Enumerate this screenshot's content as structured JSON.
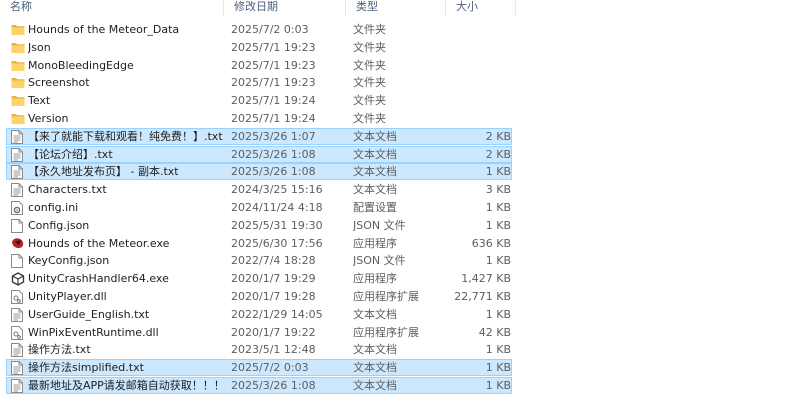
{
  "header": {
    "name": "名称",
    "date": "修改日期",
    "type": "类型",
    "size": "大小"
  },
  "files": [
    {
      "name": "Hounds of the Meteor_Data",
      "date": "2025/7/2 0:03",
      "type": "文件夹",
      "size": "",
      "icon": "folder-icon",
      "selected": false
    },
    {
      "name": "Json",
      "date": "2025/7/1 19:23",
      "type": "文件夹",
      "size": "",
      "icon": "folder-icon",
      "selected": false
    },
    {
      "name": "MonoBleedingEdge",
      "date": "2025/7/1 19:23",
      "type": "文件夹",
      "size": "",
      "icon": "folder-icon",
      "selected": false
    },
    {
      "name": "Screenshot",
      "date": "2025/7/1 19:23",
      "type": "文件夹",
      "size": "",
      "icon": "folder-icon",
      "selected": false
    },
    {
      "name": "Text",
      "date": "2025/7/1 19:24",
      "type": "文件夹",
      "size": "",
      "icon": "folder-icon",
      "selected": false
    },
    {
      "name": "Version",
      "date": "2025/7/1 19:24",
      "type": "文件夹",
      "size": "",
      "icon": "folder-icon",
      "selected": false
    },
    {
      "name": "【来了就能下载和观看！纯免费！】.txt",
      "date": "2025/3/26 1:07",
      "type": "文本文档",
      "size": "2 KB",
      "icon": "text-file-icon",
      "selected": true
    },
    {
      "name": "【论坛介绍】.txt",
      "date": "2025/3/26 1:08",
      "type": "文本文档",
      "size": "2 KB",
      "icon": "text-file-icon",
      "selected": true
    },
    {
      "name": "【永久地址发布页】 - 副本.txt",
      "date": "2025/3/26 1:08",
      "type": "文本文档",
      "size": "1 KB",
      "icon": "text-file-icon",
      "selected": true
    },
    {
      "name": "Characters.txt",
      "date": "2024/3/25 15:16",
      "type": "文本文档",
      "size": "3 KB",
      "icon": "text-file-icon",
      "selected": false
    },
    {
      "name": "config.ini",
      "date": "2024/11/24 4:18",
      "type": "配置设置",
      "size": "1 KB",
      "icon": "config-file-icon",
      "selected": false
    },
    {
      "name": "Config.json",
      "date": "2025/5/31 19:30",
      "type": "JSON 文件",
      "size": "1 KB",
      "icon": "blank-file-icon",
      "selected": false
    },
    {
      "name": "Hounds of the Meteor.exe",
      "date": "2025/6/30 17:56",
      "type": "应用程序",
      "size": "636 KB",
      "icon": "app-exe-icon",
      "selected": false
    },
    {
      "name": "KeyConfig.json",
      "date": "2022/7/4 18:28",
      "type": "JSON 文件",
      "size": "1 KB",
      "icon": "blank-file-icon",
      "selected": false
    },
    {
      "name": "UnityCrashHandler64.exe",
      "date": "2020/1/7 19:29",
      "type": "应用程序",
      "size": "1,427 KB",
      "icon": "unity-icon",
      "selected": false
    },
    {
      "name": "UnityPlayer.dll",
      "date": "2020/1/7 19:28",
      "type": "应用程序扩展",
      "size": "22,771 KB",
      "icon": "dll-file-icon",
      "selected": false
    },
    {
      "name": "UserGuide_English.txt",
      "date": "2022/1/29 14:05",
      "type": "文本文档",
      "size": "1 KB",
      "icon": "text-file-icon",
      "selected": false
    },
    {
      "name": "WinPixEventRuntime.dll",
      "date": "2020/1/7 19:22",
      "type": "应用程序扩展",
      "size": "42 KB",
      "icon": "dll-file-icon",
      "selected": false
    },
    {
      "name": "操作方法.txt",
      "date": "2023/5/1 12:48",
      "type": "文本文档",
      "size": "1 KB",
      "icon": "text-file-icon",
      "selected": false
    },
    {
      "name": "操作方法simplified.txt",
      "date": "2025/7/2 0:03",
      "type": "文本文档",
      "size": "1 KB",
      "icon": "text-file-icon",
      "selected": true
    },
    {
      "name": "最新地址及APP请发邮箱自动获取！！！....",
      "date": "2025/3/26 1:08",
      "type": "文本文档",
      "size": "1 KB",
      "icon": "text-file-icon",
      "selected": true
    }
  ]
}
